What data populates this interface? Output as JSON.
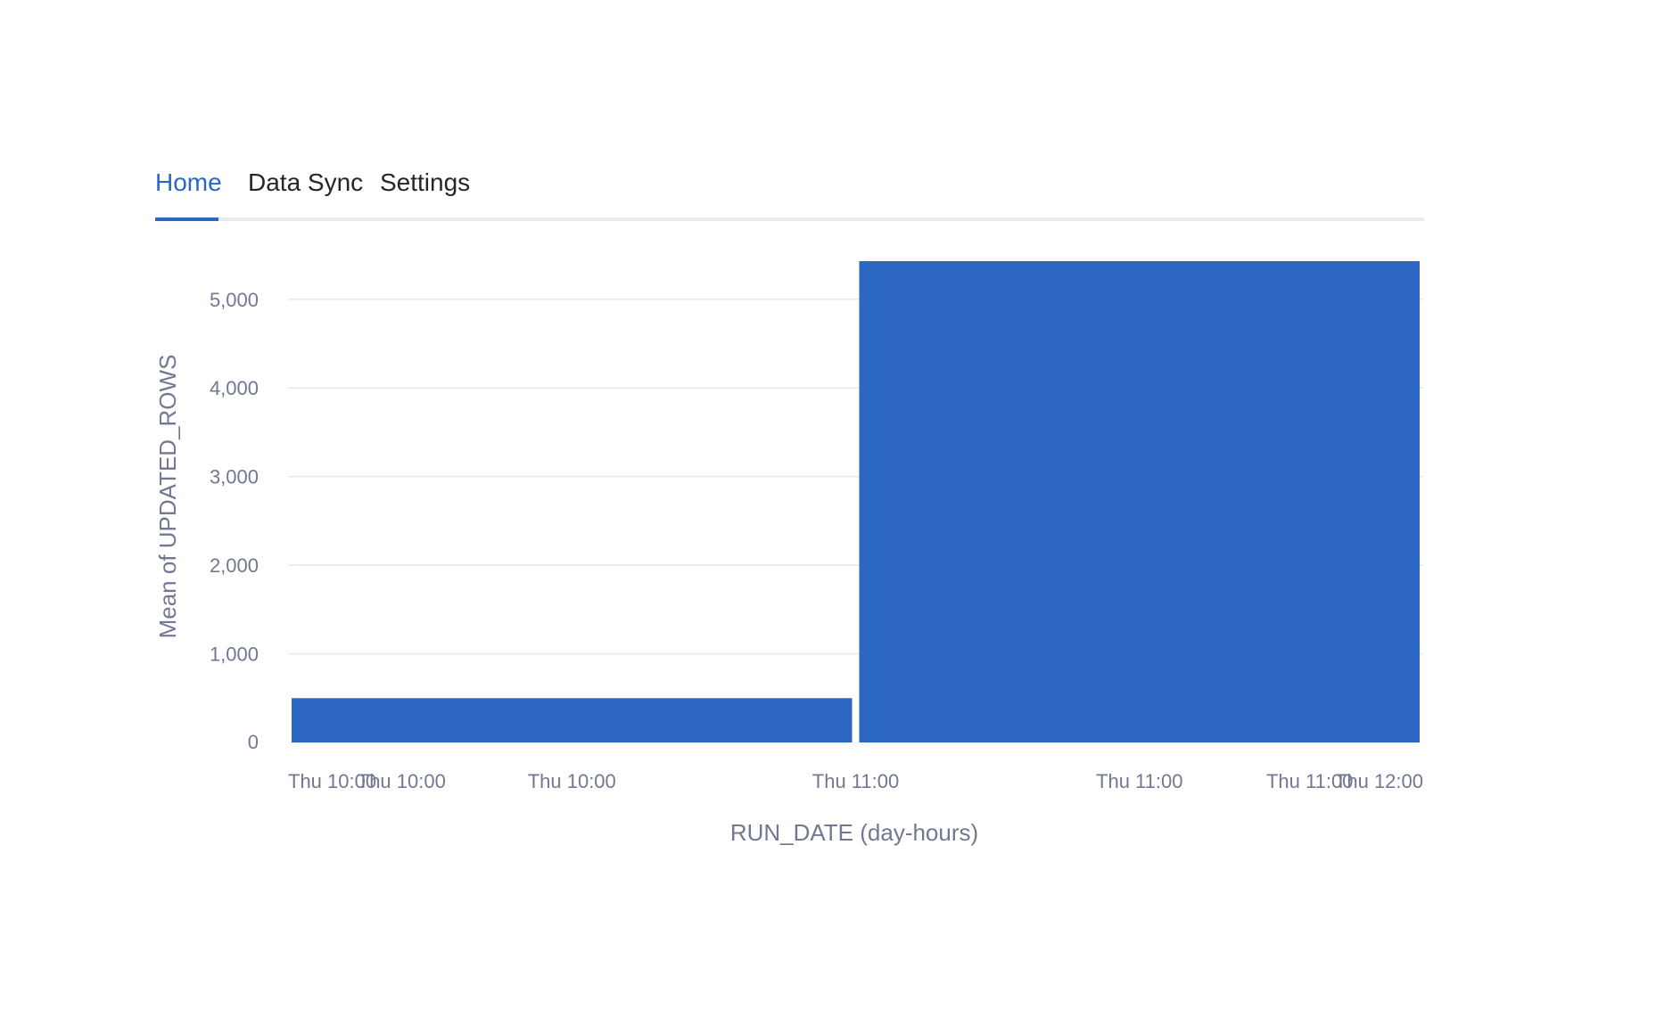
{
  "tabs": {
    "items": [
      {
        "label": "Home",
        "active": true
      },
      {
        "label": "Data Sync",
        "active": false
      },
      {
        "label": "Settings",
        "active": false
      }
    ]
  },
  "colors": {
    "accent": "#2c67c4",
    "bar": "#2c67c4",
    "axis_text": "#727891",
    "gridline": "#e6e8ee"
  },
  "chart_data": {
    "type": "bar",
    "xlabel": "RUN_DATE (day-hours)",
    "ylabel": "Mean of UPDATED_ROWS",
    "ylim": [
      0,
      5430
    ],
    "y_ticks": [
      0,
      1000,
      2000,
      3000,
      4000,
      5000
    ],
    "y_tick_labels": [
      "0",
      "1,000",
      "2,000",
      "3,000",
      "4,000",
      "5,000"
    ],
    "x_ticks": [
      {
        "label": "Thu 10:00",
        "t": 10.0
      },
      {
        "label": "Thu 10:00",
        "t": 10.2
      },
      {
        "label": "Thu 10:00",
        "t": 10.5
      },
      {
        "label": "Thu 11:00",
        "t": 11.0
      },
      {
        "label": "Thu 11:00",
        "t": 11.5
      },
      {
        "label": "Thu 11:00",
        "t": 11.8
      },
      {
        "label": "Thu 12:00",
        "t": 12.0
      }
    ],
    "x_range": [
      10.0,
      12.0
    ],
    "grid": true,
    "bars": [
      {
        "x_start": 10.0,
        "x_end": 11.0,
        "value": 500
      },
      {
        "x_start": 11.0,
        "x_end": 12.0,
        "value": 5430
      }
    ]
  }
}
